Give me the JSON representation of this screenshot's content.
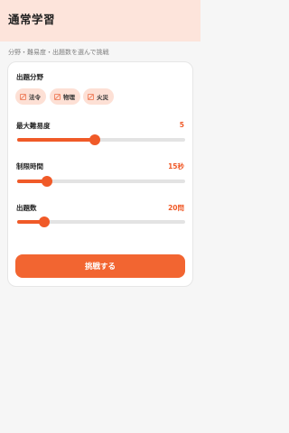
{
  "header": {
    "title": "通常学習"
  },
  "subtitle": "分野・難易度・出題数を選んで挑戦",
  "category": {
    "label": "出題分野",
    "chips": [
      {
        "label": "法令",
        "icon": "slashed-square-icon"
      },
      {
        "label": "物理",
        "icon": "slashed-square-icon"
      },
      {
        "label": "火災",
        "icon": "slashed-square-icon"
      }
    ]
  },
  "difficulty": {
    "label": "最大難易度",
    "value": "5",
    "fraction": 0.46
  },
  "time_limit": {
    "label": "制限時間",
    "value": "15秒",
    "fraction": 0.18
  },
  "question_count": {
    "label": "出題数",
    "value": "20問",
    "fraction": 0.16
  },
  "cta": {
    "label": "挑戦する"
  },
  "colors": {
    "accent": "#f05a28",
    "header_bg": "#fde4db",
    "chip_bg": "#fde0d5",
    "track": "#e3e3e3"
  }
}
